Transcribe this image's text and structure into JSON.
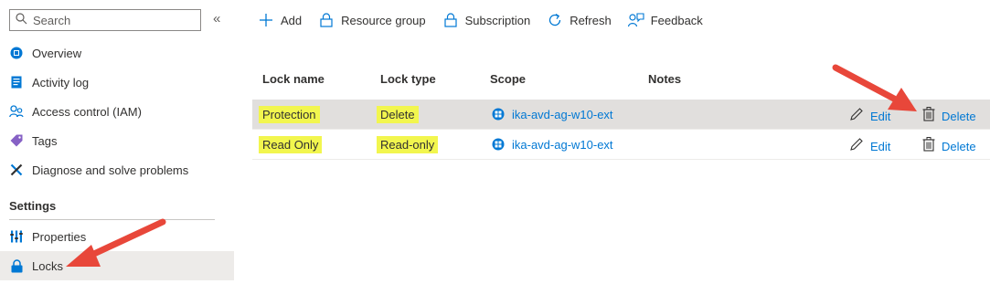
{
  "sidebar": {
    "search_placeholder": "Search",
    "collapse_glyph": "«",
    "items": [
      {
        "label": "Overview",
        "icon": "overview-icon"
      },
      {
        "label": "Activity log",
        "icon": "activity-log-icon"
      },
      {
        "label": "Access control (IAM)",
        "icon": "iam-icon"
      },
      {
        "label": "Tags",
        "icon": "tag-icon"
      },
      {
        "label": "Diagnose and solve problems",
        "icon": "diagnose-icon"
      }
    ],
    "settings_header": "Settings",
    "settings_items": [
      {
        "label": "Properties",
        "icon": "properties-icon"
      },
      {
        "label": "Locks",
        "icon": "lock-icon",
        "active": true
      }
    ]
  },
  "toolbar": {
    "add": "Add",
    "resource_group": "Resource group",
    "subscription": "Subscription",
    "refresh": "Refresh",
    "feedback": "Feedback"
  },
  "table": {
    "headers": {
      "lock_name": "Lock name",
      "lock_type": "Lock type",
      "scope": "Scope",
      "notes": "Notes"
    },
    "rows": [
      {
        "lock_name": "Protection",
        "lock_type": "Delete",
        "scope": "ika-avd-ag-w10-ext",
        "notes": "",
        "edit": "Edit",
        "delete": "Delete"
      },
      {
        "lock_name": "Read Only",
        "lock_type": "Read-only",
        "scope": "ika-avd-ag-w10-ext",
        "notes": "",
        "edit": "Edit",
        "delete": "Delete"
      }
    ]
  },
  "colors": {
    "accent": "#0078d4",
    "highlight": "#f2f64e",
    "annotation_arrow": "#e8473a",
    "selected_row": "#e1dfdd"
  }
}
